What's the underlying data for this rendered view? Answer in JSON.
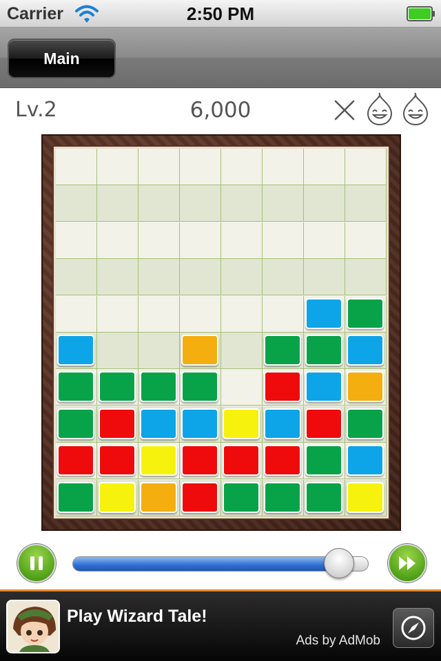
{
  "status_bar": {
    "carrier": "Carrier",
    "time": "2:50 PM",
    "wifi_icon": "wifi-icon",
    "battery_icon": "battery-icon"
  },
  "nav": {
    "main_label": "Main"
  },
  "game": {
    "level": "Lv.2",
    "score": "6,000",
    "close_icon": "close-icon",
    "lives": [
      "smiley-drop-icon",
      "smiley-drop-icon"
    ],
    "colors": {
      "B": "#0ea4e8",
      "G": "#08a348",
      "O": "#f4ae10",
      "R": "#ef0b0b",
      "Y": "#f7f20d"
    },
    "grid_cols": 8,
    "grid_rows": 10,
    "board": [
      "........",
      "........",
      "........",
      "........",
      "......BG",
      "B..O.GGB",
      "GGGG.RBO",
      "GRBBYBRG",
      "RRYRRRGB",
      "GYORGGGY"
    ],
    "progress": 0.9
  },
  "ad": {
    "title": "Play Wizard Tale!",
    "credit": "Ads by AdMob",
    "open_icon": "compass-icon"
  }
}
